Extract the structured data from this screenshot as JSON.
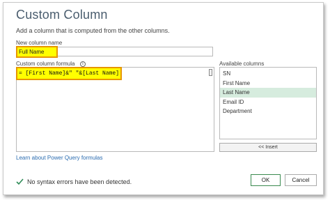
{
  "dialog": {
    "title": "Custom Column",
    "subtitle": "Add a column that is computed from the other columns."
  },
  "new_column": {
    "label": "New column name",
    "value": "Full Name"
  },
  "formula": {
    "label": "Custom column formula",
    "info_icon_glyph": "i",
    "value": "= [First Name]&\" \"&[Last Name]"
  },
  "available_columns": {
    "label": "Available columns",
    "items": [
      "SN",
      "First Name",
      "Last Name",
      "Email ID",
      "Department"
    ],
    "selected": "Last Name",
    "insert_label": "<< Insert"
  },
  "learn_link": "Learn about Power Query formulas",
  "status": {
    "text": "No syntax errors have been detected.",
    "icon": "checkmark-icon",
    "color": "#2e8b57"
  },
  "buttons": {
    "ok": "OK",
    "cancel": "Cancel"
  },
  "colors": {
    "highlight": "#ffff00",
    "highlight_border": "#e69500",
    "selection": "#d6ecde",
    "link": "#2b6cb0"
  }
}
